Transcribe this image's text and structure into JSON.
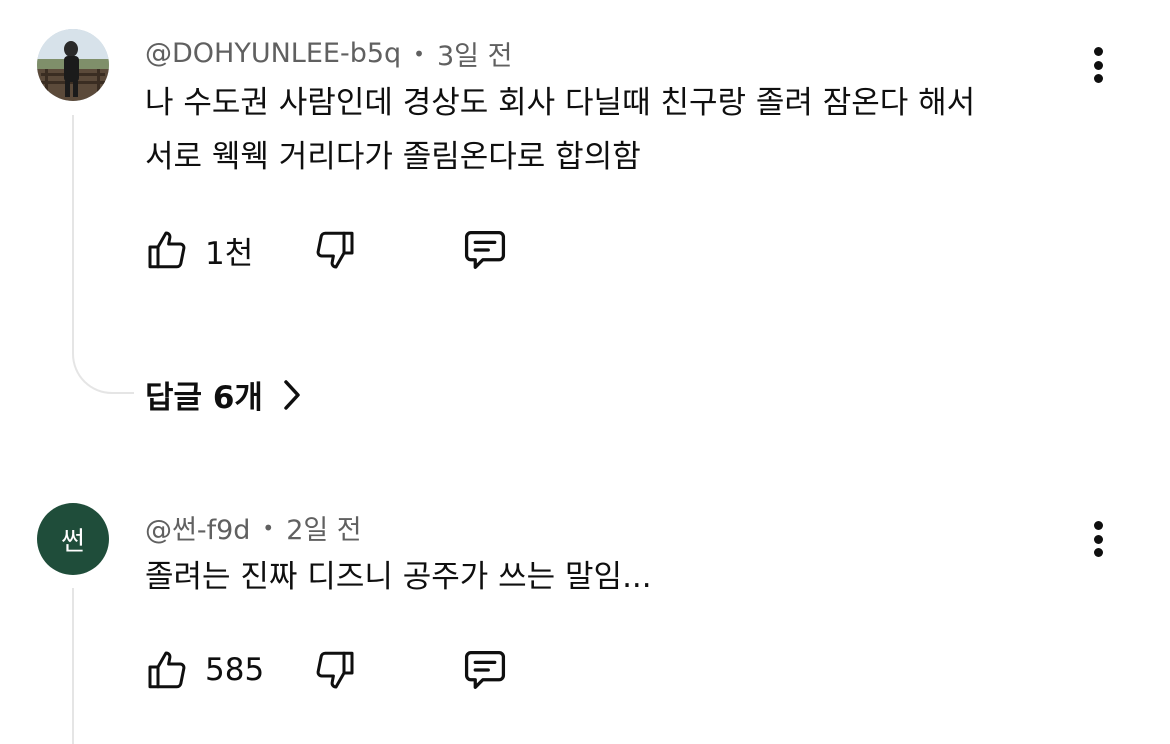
{
  "comments": [
    {
      "author": "@DOHYUNLEE-b5q",
      "separator": "•",
      "time": "3일 전",
      "lines": [
        "나 수도권 사람인데 경상도 회사 다닐때 친구랑 졸려 잠온다 해서",
        "서로 웩웩 거리다가 졸림온다로 합의함"
      ],
      "likes": "1천",
      "replies_label": "답글 6개",
      "avatar_icon": "profile-photo"
    },
    {
      "author": "@썬-f9d",
      "separator": "•",
      "time": "2일 전",
      "avatar_letter": "썬",
      "avatar_color": "#1f4d3a",
      "lines": [
        "졸려는 진짜 디즈니 공주가 쓰는 말임..."
      ],
      "likes": "585"
    }
  ],
  "icons": {
    "like": "thumbs-up-icon",
    "dislike": "thumbs-down-icon",
    "reply": "comment-icon",
    "menu": "more-vert-icon",
    "chevron": "chevron-right-icon"
  }
}
